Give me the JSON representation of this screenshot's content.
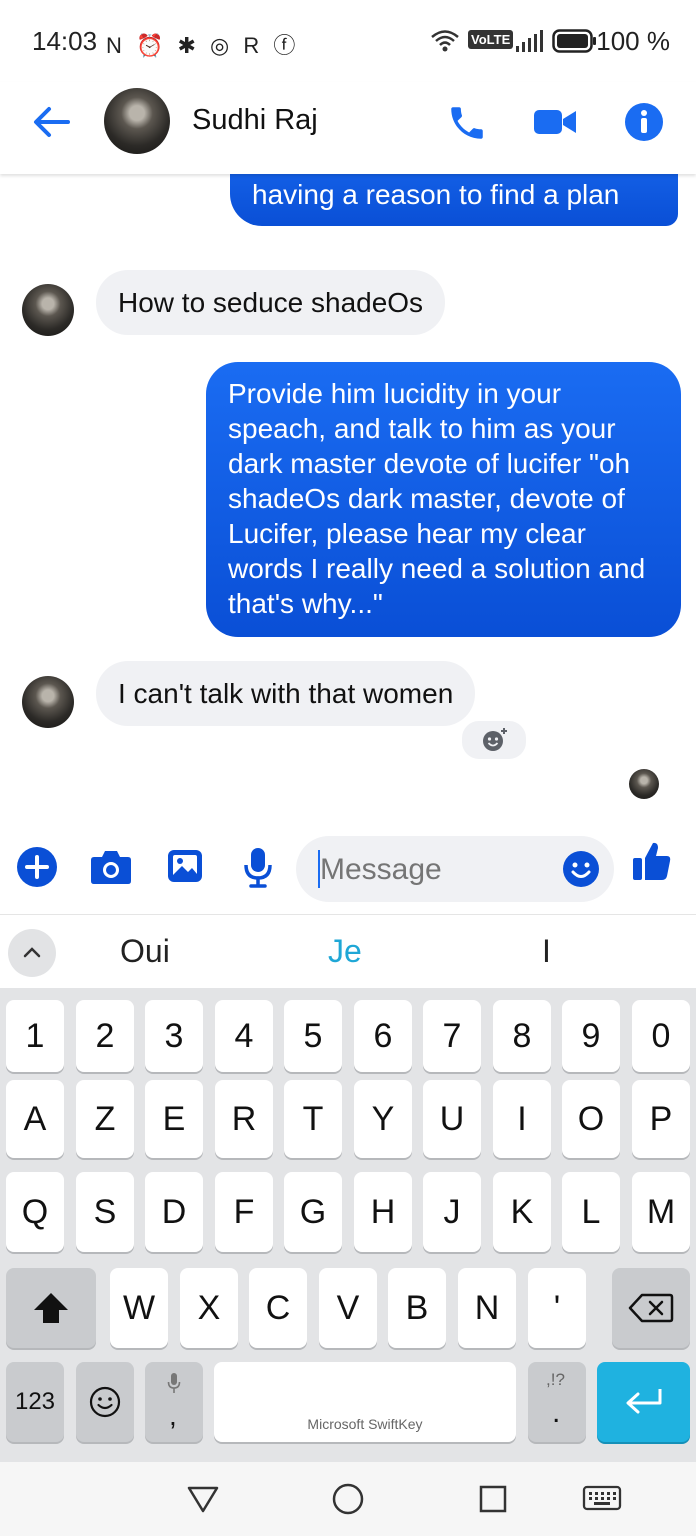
{
  "status_bar": {
    "time": "14:03",
    "left_icons": "N ⏰ ✱ ◎ R ⓕ",
    "network_label": "VoLTE",
    "battery": "100 %"
  },
  "header": {
    "contact_name": "Sudhi Raj"
  },
  "messages": [
    {
      "id": "m1",
      "side": "out",
      "text": "Then seduce shadeOs into having a reason to find a plan"
    },
    {
      "id": "m2",
      "side": "in",
      "text": "How to seduce shadeOs"
    },
    {
      "id": "m3",
      "side": "out",
      "text": "Provide him lucidity in your speach, and talk to him as your dark master devote of lucifer \"oh shadeOs dark master, devote of Lucifer, please hear my clear words I really need a solution and that's why...\""
    },
    {
      "id": "m4",
      "side": "in",
      "text": "I can't talk with that women"
    }
  ],
  "composer": {
    "placeholder": "Message"
  },
  "keyboard": {
    "suggestions": [
      "Oui",
      "Je",
      "I"
    ],
    "row_numbers": [
      "1",
      "2",
      "3",
      "4",
      "5",
      "6",
      "7",
      "8",
      "9",
      "0"
    ],
    "row1": [
      "A",
      "Z",
      "E",
      "R",
      "T",
      "Y",
      "U",
      "I",
      "O",
      "P"
    ],
    "row2": [
      "Q",
      "S",
      "D",
      "F",
      "G",
      "H",
      "J",
      "K",
      "L",
      "M"
    ],
    "row3": [
      "W",
      "X",
      "C",
      "V",
      "B",
      "N",
      "'"
    ],
    "mode_key": "123",
    "comma": ",",
    "period": ".",
    "punct_hint": ",!?",
    "space_label": "Microsoft SwiftKey"
  },
  "colors": {
    "accent": "#1a6cf2",
    "outgoing_bubble": "#0a4fd6",
    "incoming_bubble": "#f0f1f4",
    "enter_key": "#1fb2e0"
  }
}
